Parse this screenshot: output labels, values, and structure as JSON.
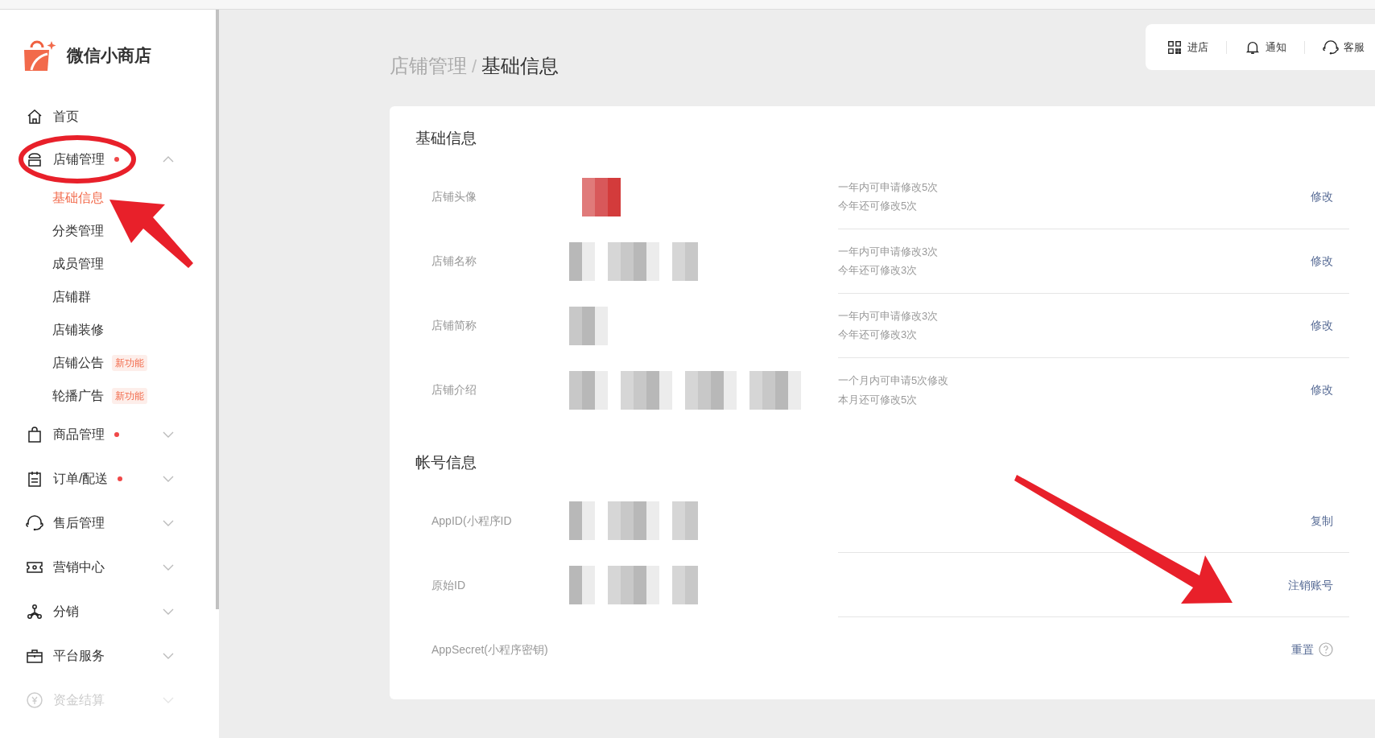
{
  "app": {
    "name": "微信小商店"
  },
  "sidebar": {
    "items": [
      {
        "label": "首页",
        "kind": "home",
        "dot": false,
        "disabled": false
      },
      {
        "label": "店铺管理",
        "kind": "shop",
        "dot": true,
        "expanded": true,
        "disabled": false,
        "children": [
          {
            "label": "基础信息",
            "selected": true
          },
          {
            "label": "分类管理",
            "selected": false
          },
          {
            "label": "成员管理",
            "selected": false
          },
          {
            "label": "店铺群",
            "selected": false
          },
          {
            "label": "店铺装修",
            "selected": false
          },
          {
            "label": "店铺公告",
            "selected": false,
            "tag": "新功能"
          },
          {
            "label": "轮播广告",
            "selected": false,
            "tag": "新功能"
          }
        ]
      },
      {
        "label": "商品管理",
        "kind": "bag",
        "dot": true,
        "expanded": false,
        "disabled": false
      },
      {
        "label": "订单/配送",
        "kind": "clipboard",
        "dot": true,
        "expanded": false,
        "disabled": false
      },
      {
        "label": "售后管理",
        "kind": "headset",
        "dot": false,
        "expanded": false,
        "disabled": false
      },
      {
        "label": "营销中心",
        "kind": "ticket",
        "dot": false,
        "expanded": false,
        "disabled": false
      },
      {
        "label": "分销",
        "kind": "network",
        "dot": false,
        "expanded": false,
        "disabled": false
      },
      {
        "label": "平台服务",
        "kind": "briefcase",
        "dot": false,
        "expanded": false,
        "disabled": false
      },
      {
        "label": "资金结算",
        "kind": "yen",
        "dot": false,
        "expanded": false,
        "disabled": true
      }
    ]
  },
  "breadcrumb": {
    "items": [
      "店铺管理",
      "基础信息"
    ],
    "separator": "/"
  },
  "toolbar": [
    {
      "label": "进店",
      "kind": "qr"
    },
    {
      "label": "通知",
      "kind": "bell"
    },
    {
      "label": "客服",
      "kind": "headset"
    }
  ],
  "sections": [
    {
      "title": "基础信息",
      "rows": [
        {
          "label": "店铺头像",
          "notes": [
            "一年内可申请修改5次",
            "今年还可修改5次"
          ],
          "action": "修改"
        },
        {
          "label": "店铺名称",
          "notes": [
            "一年内可申请修改3次",
            "今年还可修改3次"
          ],
          "action": "修改"
        },
        {
          "label": "店铺简称",
          "notes": [
            "一年内可申请修改3次",
            "今年还可修改3次"
          ],
          "action": "修改"
        },
        {
          "label": "店铺介绍",
          "notes": [
            "一个月内可申请5次修改",
            "本月还可修改5次"
          ],
          "action": "修改"
        }
      ]
    },
    {
      "title": "帐号信息",
      "rows": [
        {
          "label": "AppID(小程序ID",
          "action": "复制"
        },
        {
          "label": "原始ID",
          "action": "注销账号"
        },
        {
          "label": "AppSecret(小程序密钥)",
          "action": "重置",
          "help": true
        }
      ]
    }
  ]
}
